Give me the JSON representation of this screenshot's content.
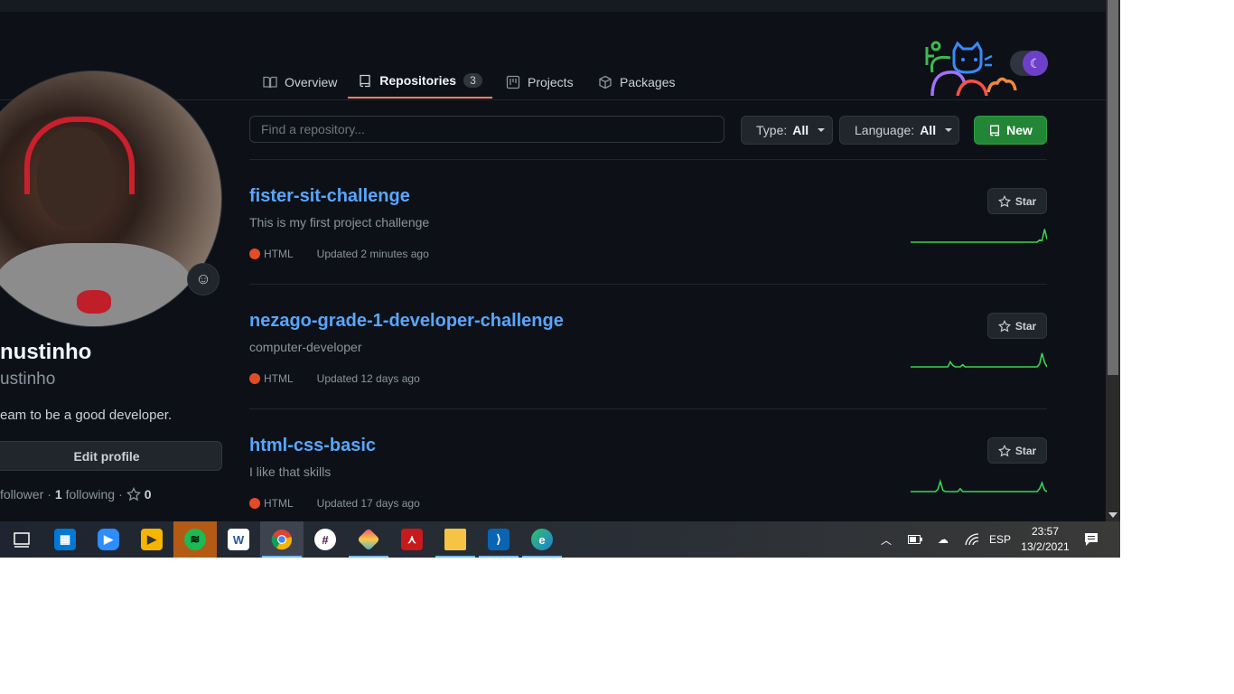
{
  "nav": {
    "tabs": [
      {
        "label": "Overview",
        "icon": "book-icon"
      },
      {
        "label": "Repositories",
        "icon": "repo-icon",
        "count": "3",
        "selected": true
      },
      {
        "label": "Projects",
        "icon": "project-icon"
      },
      {
        "label": "Packages",
        "icon": "package-icon"
      }
    ]
  },
  "theme_toggle": {
    "icon": "moon-icon",
    "state": "dark"
  },
  "profile": {
    "name": "nustinho",
    "login": "ustinho",
    "bio": "eam to be a good developer.",
    "edit_label": "Edit profile",
    "followers_count": "",
    "followers_label": "follower",
    "separator": "·",
    "following_count": "1",
    "following_label": "following",
    "stars_count": "0"
  },
  "filters": {
    "search_placeholder": "Find a repository...",
    "type_label": "Type:",
    "type_value": "All",
    "language_label": "Language:",
    "language_value": "All",
    "new_label": "New"
  },
  "repos": [
    {
      "name": "fister-sit-challenge",
      "description": "This is my first project challenge",
      "language": "HTML",
      "updated": "Updated 2 minutes ago",
      "star_label": "Star",
      "activity": [
        0,
        0,
        0,
        0,
        0,
        0,
        0,
        0,
        0,
        0,
        0,
        0,
        0,
        0,
        0,
        0,
        0,
        0,
        0,
        0,
        0,
        0,
        0,
        0,
        0,
        0,
        0,
        0,
        0,
        0,
        0,
        0,
        0,
        0,
        0,
        0,
        0,
        0,
        0,
        0,
        0,
        0,
        0,
        0,
        0,
        0,
        0,
        0,
        0,
        0,
        0,
        0,
        0.15,
        0.1,
        0.9,
        0.2
      ]
    },
    {
      "name": "nezago-grade-1-developer-challenge",
      "description": "computer-developer",
      "language": "HTML",
      "updated": "Updated 12 days ago",
      "star_label": "Star",
      "activity": [
        0,
        0,
        0,
        0,
        0,
        0,
        0,
        0,
        0,
        0,
        0,
        0,
        0,
        0,
        0,
        0,
        0.35,
        0.1,
        0,
        0,
        0,
        0.15,
        0,
        0,
        0,
        0,
        0,
        0,
        0,
        0,
        0,
        0,
        0,
        0,
        0,
        0,
        0,
        0,
        0,
        0,
        0,
        0,
        0,
        0,
        0,
        0,
        0,
        0,
        0,
        0,
        0,
        0,
        0.2,
        0.95,
        0.3,
        0
      ]
    },
    {
      "name": "html-css-basic",
      "description": "I like that skills",
      "language": "HTML",
      "updated": "Updated 17 days ago",
      "star_label": "Star",
      "activity": [
        0,
        0,
        0,
        0,
        0,
        0,
        0,
        0,
        0,
        0,
        0,
        0.15,
        0.7,
        0.1,
        0,
        0,
        0,
        0,
        0,
        0,
        0.2,
        0,
        0,
        0,
        0,
        0,
        0,
        0,
        0,
        0,
        0,
        0,
        0,
        0,
        0,
        0,
        0,
        0,
        0,
        0,
        0,
        0,
        0,
        0,
        0,
        0,
        0,
        0,
        0,
        0,
        0,
        0,
        0.2,
        0.6,
        0.1,
        0
      ]
    }
  ],
  "colors": {
    "accent_link": "#58a6ff",
    "html_lang": "#e34c26",
    "new_button": "#238636",
    "tab_underline": "#f78166",
    "spark_line": "#39d353"
  },
  "taskbar": {
    "apps": [
      "task-view-icon",
      "store-icon",
      "zoom-icon",
      "video-player-icon",
      "spotify-icon",
      "word-icon",
      "chrome-icon",
      "slack-icon",
      "git-icon",
      "acrobat-icon",
      "file-explorer-icon",
      "vscode-icon",
      "edge-icon"
    ],
    "tray": {
      "language": "ESP",
      "time": "23:57",
      "date": "13/2/2021"
    }
  }
}
